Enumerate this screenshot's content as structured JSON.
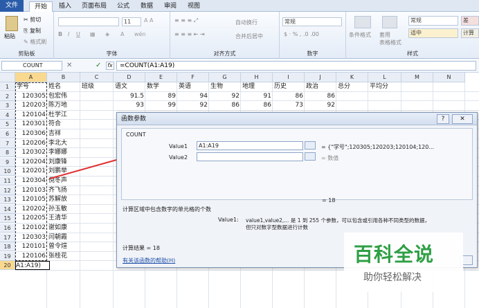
{
  "ribbon_tabs": [
    "文件",
    "开始",
    "插入",
    "页面布局",
    "公式",
    "数据",
    "审阅",
    "视图"
  ],
  "clipboard": {
    "paste": "粘贴",
    "cut": "剪切",
    "copy": "复制",
    "format_painter": "格式刷",
    "label": "剪贴板"
  },
  "font": {
    "name": "",
    "size": "11",
    "label": "字体"
  },
  "alignment": {
    "wrap": "自动换行",
    "merge": "合并后居中",
    "label": "对齐方式"
  },
  "number": {
    "format": "常规",
    "label": "数字"
  },
  "styles": {
    "conditional": "条件格式",
    "table": "套用\n表格格式",
    "normal": "常规",
    "good": "适中",
    "bad": "差",
    "calc": "计算",
    "label": "样式"
  },
  "formula_bar": {
    "name_box": "COUNT",
    "formula": "=COUNT(A1:A19)"
  },
  "columns": [
    "A",
    "B",
    "C",
    "D",
    "E",
    "F",
    "G",
    "H",
    "I",
    "J",
    "K",
    "L",
    "M",
    "N"
  ],
  "rows": [
    [
      "学号",
      "姓名",
      "班级",
      "语文",
      "数学",
      "英语",
      "生物",
      "地理",
      "历史",
      "政治",
      "总分",
      "平均分"
    ],
    [
      "120305",
      "包宏伟",
      "",
      "91.5",
      "89",
      "94",
      "92",
      "91",
      "86",
      "86",
      "",
      ""
    ],
    [
      "120203",
      "陈万地",
      "",
      "93",
      "99",
      "92",
      "86",
      "86",
      "73",
      "92",
      "",
      ""
    ],
    [
      "120104",
      "杜学江",
      "",
      "",
      "",
      "",
      "",
      "",
      "",
      "",
      "",
      ""
    ],
    [
      "120301",
      "符合",
      "",
      "",
      "",
      "",
      "",
      "",
      "",
      "",
      "",
      ""
    ],
    [
      "120306",
      "吉祥",
      "",
      "",
      "",
      "",
      "",
      "",
      "",
      "",
      "",
      ""
    ],
    [
      "120206",
      "李北大",
      "",
      "",
      "",
      "",
      "",
      "",
      "",
      "",
      "",
      ""
    ],
    [
      "120302",
      "李娜娜",
      "",
      "",
      "",
      "",
      "",
      "",
      "",
      "",
      "",
      ""
    ],
    [
      "120204",
      "刘康锋",
      "",
      "",
      "",
      "",
      "",
      "",
      "",
      "",
      "",
      ""
    ],
    [
      "120201",
      "刘鹏举",
      "",
      "",
      "",
      "",
      "",
      "",
      "",
      "",
      "",
      ""
    ],
    [
      "120304",
      "倪冬声",
      "",
      "",
      "",
      "",
      "",
      "",
      "",
      "",
      "",
      ""
    ],
    [
      "120103",
      "齐飞扬",
      "",
      "",
      "",
      "",
      "",
      "",
      "",
      "",
      "",
      ""
    ],
    [
      "120105",
      "苏解放",
      "",
      "",
      "",
      "",
      "",
      "",
      "",
      "",
      "",
      ""
    ],
    [
      "120202",
      "孙玉敏",
      "",
      "",
      "",
      "",
      "",
      "",
      "",
      "",
      "",
      ""
    ],
    [
      "120205",
      "王清华",
      "",
      "",
      "",
      "",
      "",
      "",
      "",
      "",
      "",
      ""
    ],
    [
      "120102",
      "谢如康",
      "",
      "",
      "",
      "",
      "",
      "",
      "",
      "",
      "",
      ""
    ],
    [
      "120303",
      "闫朝霞",
      "",
      "",
      "",
      "",
      "",
      "",
      "",
      "",
      "",
      ""
    ],
    [
      "120101",
      "曾令煊",
      "",
      "",
      "",
      "",
      "",
      "",
      "",
      "",
      "",
      ""
    ],
    [
      "120106",
      "张桂花",
      "",
      "",
      "",
      "",
      "",
      "",
      "",
      "",
      "",
      ""
    ],
    [
      "A1:A19)",
      "",
      "",
      "",
      "",
      "",
      "",
      "",
      "",
      "",
      "",
      ""
    ]
  ],
  "dialog": {
    "title": "函数参数",
    "function": "COUNT",
    "value1_label": "Value1",
    "value1": "A1:A19",
    "value1_result": "= {\"学号\";120305;120203;120104;120...",
    "value2_label": "Value2",
    "value2_result": "= 数值",
    "total": "= 18",
    "description": "计算区域中包含数字的单元格的个数",
    "arg_help_name": "Value1:",
    "arg_help_line1": "value1,value2,... 是 1 到 255 个参数，可以包含或引用各种不同类型的数据，",
    "arg_help_line2": "但只对数字型数据进行计数",
    "result": "计算结果 = 18",
    "help_link": "有关该函数的帮助(H)",
    "help_button": "?"
  },
  "watermark": {
    "title": "百科全说",
    "subtitle": "助你轻松解决"
  },
  "colors": {
    "accent": "#2a5caa",
    "watermark": "#2e9f44",
    "arrow": "#e03030"
  }
}
